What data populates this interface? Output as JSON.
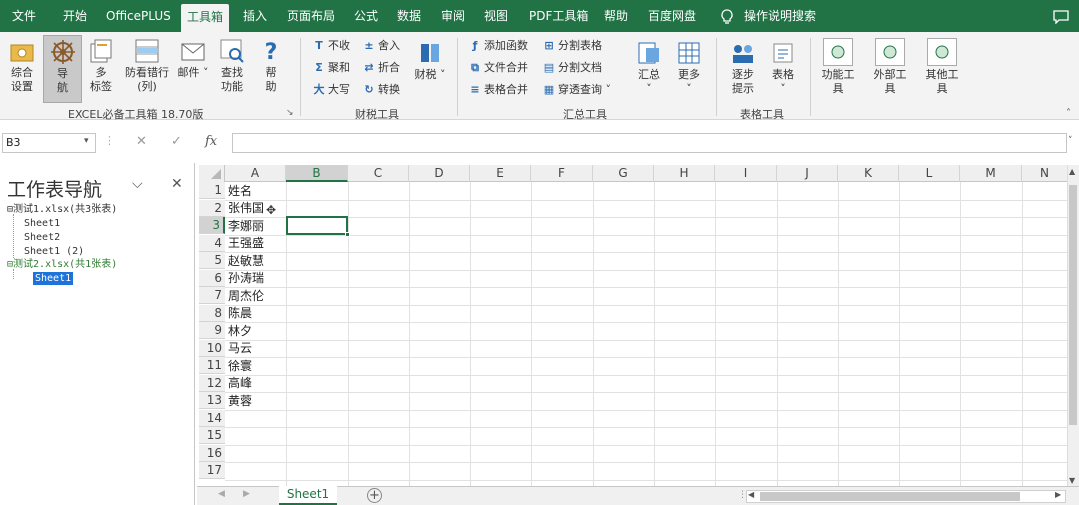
{
  "menu": [
    "文件",
    "开始",
    "OfficePLUS",
    "工具箱",
    "插入",
    "页面布局",
    "公式",
    "数据",
    "审阅",
    "视图",
    "PDF工具箱",
    "帮助",
    "百度网盘",
    "操作说明搜索"
  ],
  "ribbon": {
    "big": [
      "综合\n设置",
      "导\n航",
      "多\n标签",
      "防看错行\n(列)",
      "邮件",
      "查找\n功能",
      "帮\n助"
    ],
    "group1": "EXCEL必备工具箱 18.70版",
    "finance": [
      "不收",
      "舍入",
      "聚和",
      "折合",
      "大写",
      "转换"
    ],
    "finance_menu": "财税",
    "group2": "财税工具",
    "summary": [
      "添加函数",
      "分割表格",
      "文件合并",
      "分割文档",
      "表格合并",
      "穿透查询"
    ],
    "summary_big": "汇总",
    "more": "更多",
    "group3": "汇总工具",
    "table_btns": [
      "逐步\n提示",
      "表格"
    ],
    "group4": "表格工具",
    "other": [
      "功能工\n具",
      "外部工\n具",
      "其他工\n具"
    ]
  },
  "formula": {
    "namebox": "B3",
    "fx": "fx",
    "cancel": "✕",
    "ok": "✓"
  },
  "nav": {
    "title": "工作表导航",
    "tree": [
      "测试1.xlsx(共3张表)",
      "Sheet1",
      "Sheet2",
      "Sheet1 (2)",
      "测试2.xlsx(共1张表)",
      "Sheet1"
    ]
  },
  "grid": {
    "cols": [
      "A",
      "B",
      "C",
      "D",
      "E",
      "F",
      "G",
      "H",
      "I",
      "J",
      "K",
      "L",
      "M",
      "N"
    ],
    "rows": [
      "1",
      "2",
      "3",
      "4",
      "5",
      "6",
      "7",
      "8",
      "9",
      "10",
      "11",
      "12",
      "13",
      "14",
      "15",
      "16",
      "17"
    ],
    "colA": [
      "姓名",
      "张伟国",
      "李娜丽",
      "王强盛",
      "赵敏慧",
      "孙涛瑞",
      "周杰伦",
      "陈晨",
      "林夕",
      "马云",
      "徐寰",
      "高峰",
      "黄蓉"
    ]
  },
  "sheet_tab": "Sheet1",
  "add_sheet": "+",
  "colors": {
    "accent": "#217346"
  }
}
